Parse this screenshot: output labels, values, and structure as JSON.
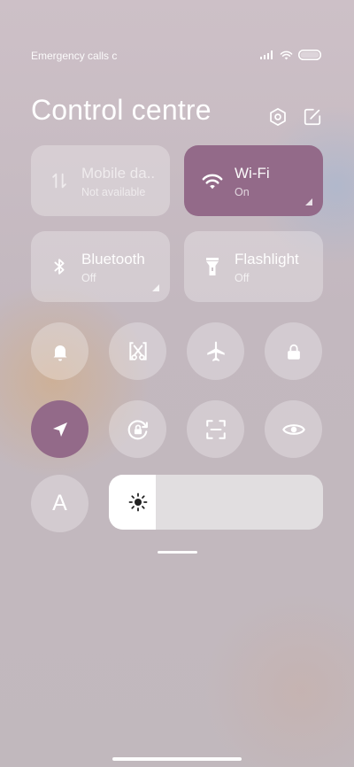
{
  "status_bar": {
    "carrier_text": "Emergency calls c",
    "icons": [
      "signal-icon",
      "wifi-icon",
      "battery-icon"
    ]
  },
  "header": {
    "title": "Control centre",
    "icons": [
      "settings-icon",
      "edit-icon"
    ]
  },
  "tiles": [
    {
      "name": "mobile-data",
      "label": "Mobile da..",
      "status": "Not available",
      "icon": "mobile-data-icon",
      "state": "unavailable"
    },
    {
      "name": "wifi",
      "label": "Wi-Fi",
      "status": "On",
      "icon": "wifi-icon",
      "state": "on"
    },
    {
      "name": "bluetooth",
      "label": "Bluetooth",
      "status": "Off",
      "icon": "bluetooth-icon",
      "state": "off"
    },
    {
      "name": "flashlight",
      "label": "Flashlight",
      "status": "Off",
      "icon": "flashlight-icon",
      "state": "off"
    }
  ],
  "toggles": [
    {
      "name": "ringer",
      "icon": "bell-icon",
      "active": false
    },
    {
      "name": "screenshot",
      "icon": "scissors-icon",
      "active": false
    },
    {
      "name": "airplane-mode",
      "icon": "airplane-icon",
      "active": false
    },
    {
      "name": "lock-screen",
      "icon": "lock-icon",
      "active": false
    },
    {
      "name": "location",
      "icon": "location-arrow-icon",
      "active": true
    },
    {
      "name": "rotation-lock",
      "icon": "rotation-lock-icon",
      "active": false
    },
    {
      "name": "scanner",
      "icon": "scan-icon",
      "active": false
    },
    {
      "name": "reading-mode",
      "icon": "eye-icon",
      "active": false
    }
  ],
  "auto_brightness_glyph": "A",
  "brightness": {
    "level": 0.22,
    "icon": "sun-icon"
  },
  "colors": {
    "accent": "#936a89",
    "tile_bg": "rgba(255,255,255,0.28)",
    "text": "#ffffff"
  }
}
